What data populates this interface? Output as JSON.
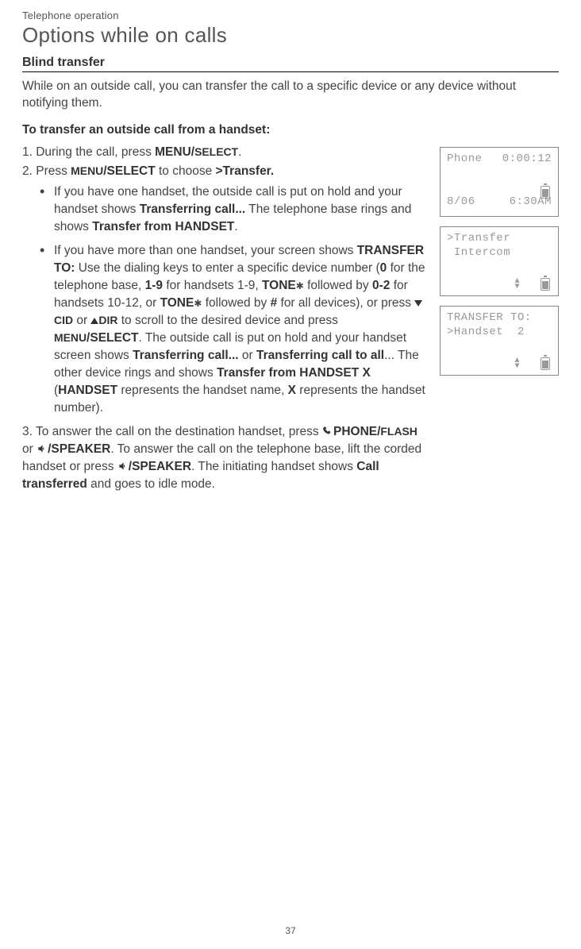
{
  "header": {
    "category": "Telephone operation",
    "section_title": "Options while on calls",
    "subsection_title": "Blind transfer"
  },
  "intro": "While on an outside call, you can transfer the call to a specific device or any device without notifying them.",
  "sub_heading": "To transfer an outside call from a handset:",
  "steps": {
    "s1_pre": "1. During the call, press ",
    "s1_b1": "MENU/",
    "s1_sc": "SELECT",
    "s1_post": ".",
    "s2_pre": "2. Press ",
    "s2_sc1": "MENU",
    "s2_b1": "/SELECT",
    "s2_mid": " to choose ",
    "s2_b2": ">Transfer.",
    "b1_t1": "If you have one handset, the outside call is put on hold and your handset shows ",
    "b1_b1": "Transferring call...",
    "b1_t2": " The telephone base rings and shows ",
    "b1_b2": "Transfer from HANDSET",
    "b1_t3": ".",
    "b2_t1": "If you have more than one handset, your screen shows ",
    "b2_b1": "TRANSFER TO:",
    "b2_t2": " Use the dialing keys to enter a specific device number (",
    "b2_b2": "0",
    "b2_t3": " for the telephone base, ",
    "b2_b3": "1-9",
    "b2_t4": " for handsets 1-9, ",
    "b2_b4": "TONE",
    "b2_t5": " followed by ",
    "b2_b5": "0-2",
    "b2_t6": " for handsets 10-12, or ",
    "b2_b6": "TONE",
    "b2_t7": " followed by ",
    "b2_b7": "#",
    "b2_t8": " for all devices), or press ",
    "b2_sc_cid": "CID",
    "b2_t9": " or ",
    "b2_sc_dir": "DIR",
    "b2_t10": " to scroll to the desired device and press ",
    "b2_sc_menu": "MENU",
    "b2_b8": "/SELECT",
    "b2_t11": ". The outside call is put on hold and your handset screen shows ",
    "b2_b9": "Transferring call...",
    "b2_t12": " or ",
    "b2_b10": "Transferring call to all",
    "b2_t13": "... The other device rings and shows ",
    "b2_b11": "Transfer from HANDSET X",
    "b2_t14": " (",
    "b2_b12": "HANDSET",
    "b2_t15": " represents the handset name, ",
    "b2_b13": "X",
    "b2_t16": " represents the handset number).",
    "s3_t1": "3. To answer the call on the destination handset, press ",
    "s3_b1": "PHONE/",
    "s3_sc1": "FLASH",
    "s3_t2": " or ",
    "s3_b2": "/SPEAKER",
    "s3_t3": ". To answer the call on the telephone base, lift the corded handset or press ",
    "s3_b3": "/SPEAKER",
    "s3_t4": ". The initiating handset shows ",
    "s3_b4": "Call transferred",
    "s3_t5": " and goes to idle mode."
  },
  "screens": {
    "s1": {
      "line1_left": "Phone",
      "line1_right": "0:00:12",
      "line4_left": "8/06",
      "line4_right": "6:30AM"
    },
    "s2": {
      "line1": ">Transfer",
      "line2": " Intercom"
    },
    "s3": {
      "line1": "TRANSFER TO:",
      "line2": ">Handset  2"
    }
  },
  "page_number": "37"
}
